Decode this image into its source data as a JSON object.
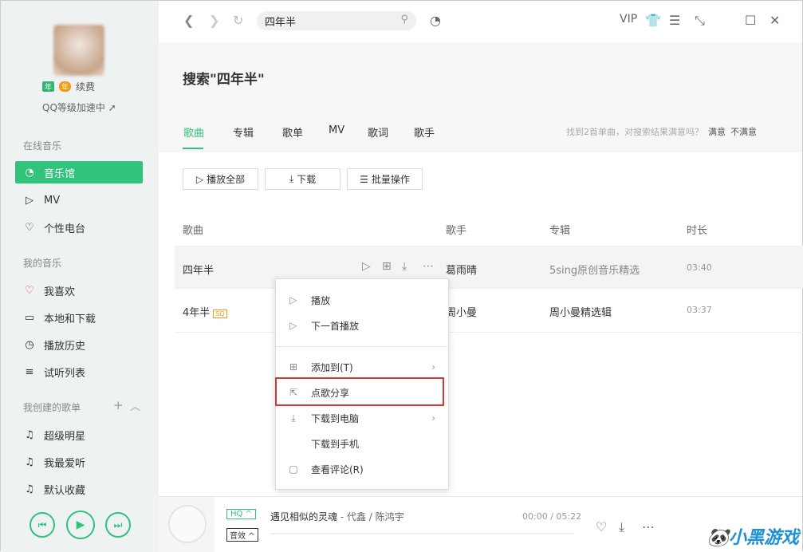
{
  "user": {
    "renew": "续费",
    "badge1": "年",
    "badge2": "年",
    "qq_level": "QQ等级加速中"
  },
  "sidebar": {
    "sections": [
      "在线音乐",
      "我的音乐",
      "我创建的歌单"
    ],
    "online": [
      {
        "icon": "music-hall-icon",
        "label": "音乐馆"
      },
      {
        "icon": "mv-icon",
        "label": "MV"
      },
      {
        "icon": "radio-icon",
        "label": "个性电台"
      }
    ],
    "mine": [
      {
        "icon": "heart-icon",
        "label": "我喜欢"
      },
      {
        "icon": "monitor-icon",
        "label": "本地和下载"
      },
      {
        "icon": "clock-icon",
        "label": "播放历史"
      },
      {
        "icon": "playlist-icon",
        "label": "试听列表"
      }
    ],
    "playlists": [
      {
        "label": "超级明星"
      },
      {
        "label": "我最爱听"
      },
      {
        "label": "默认收藏"
      }
    ]
  },
  "toolbar": {
    "search_value": "四年半",
    "vip": "VIP"
  },
  "header": {
    "title": "搜索\"四年半\"",
    "tabs": [
      "歌曲",
      "专辑",
      "歌单",
      "MV",
      "歌词",
      "歌手"
    ],
    "satisfaction": "找到2首单曲，对搜索结果满意吗？",
    "satisfied": "满意",
    "unsatisfied": "不满意"
  },
  "actions": {
    "play_all": "播放全部",
    "download": "下载",
    "batch": "批量操作"
  },
  "table": {
    "headers": [
      "歌曲",
      "歌手",
      "专辑",
      "时长"
    ],
    "rows": [
      {
        "song": "四年半",
        "singer": "葛雨晴",
        "album": "5sing原创音乐精选",
        "duration": "03:40"
      },
      {
        "song": "4年半",
        "badge": "SQ",
        "singer": "周小曼",
        "album": "周小曼精选辑",
        "duration": "03:37"
      }
    ]
  },
  "menu": {
    "items": [
      {
        "label": "播放"
      },
      {
        "label": "下一首播放"
      },
      {
        "label": "添加到(T)"
      },
      {
        "label": "点歌分享"
      },
      {
        "label": "下载到电脑"
      },
      {
        "label": "下载到手机"
      },
      {
        "label": "查看评论(R)"
      }
    ]
  },
  "player": {
    "quality": "HQ ^",
    "effect": "音效 ^",
    "song": "遇见相似的灵魂",
    "artist": " - 代鑫 / 陈鸿宇",
    "time": "00:00 / 05:22"
  },
  "watermark": "小黑游戏"
}
